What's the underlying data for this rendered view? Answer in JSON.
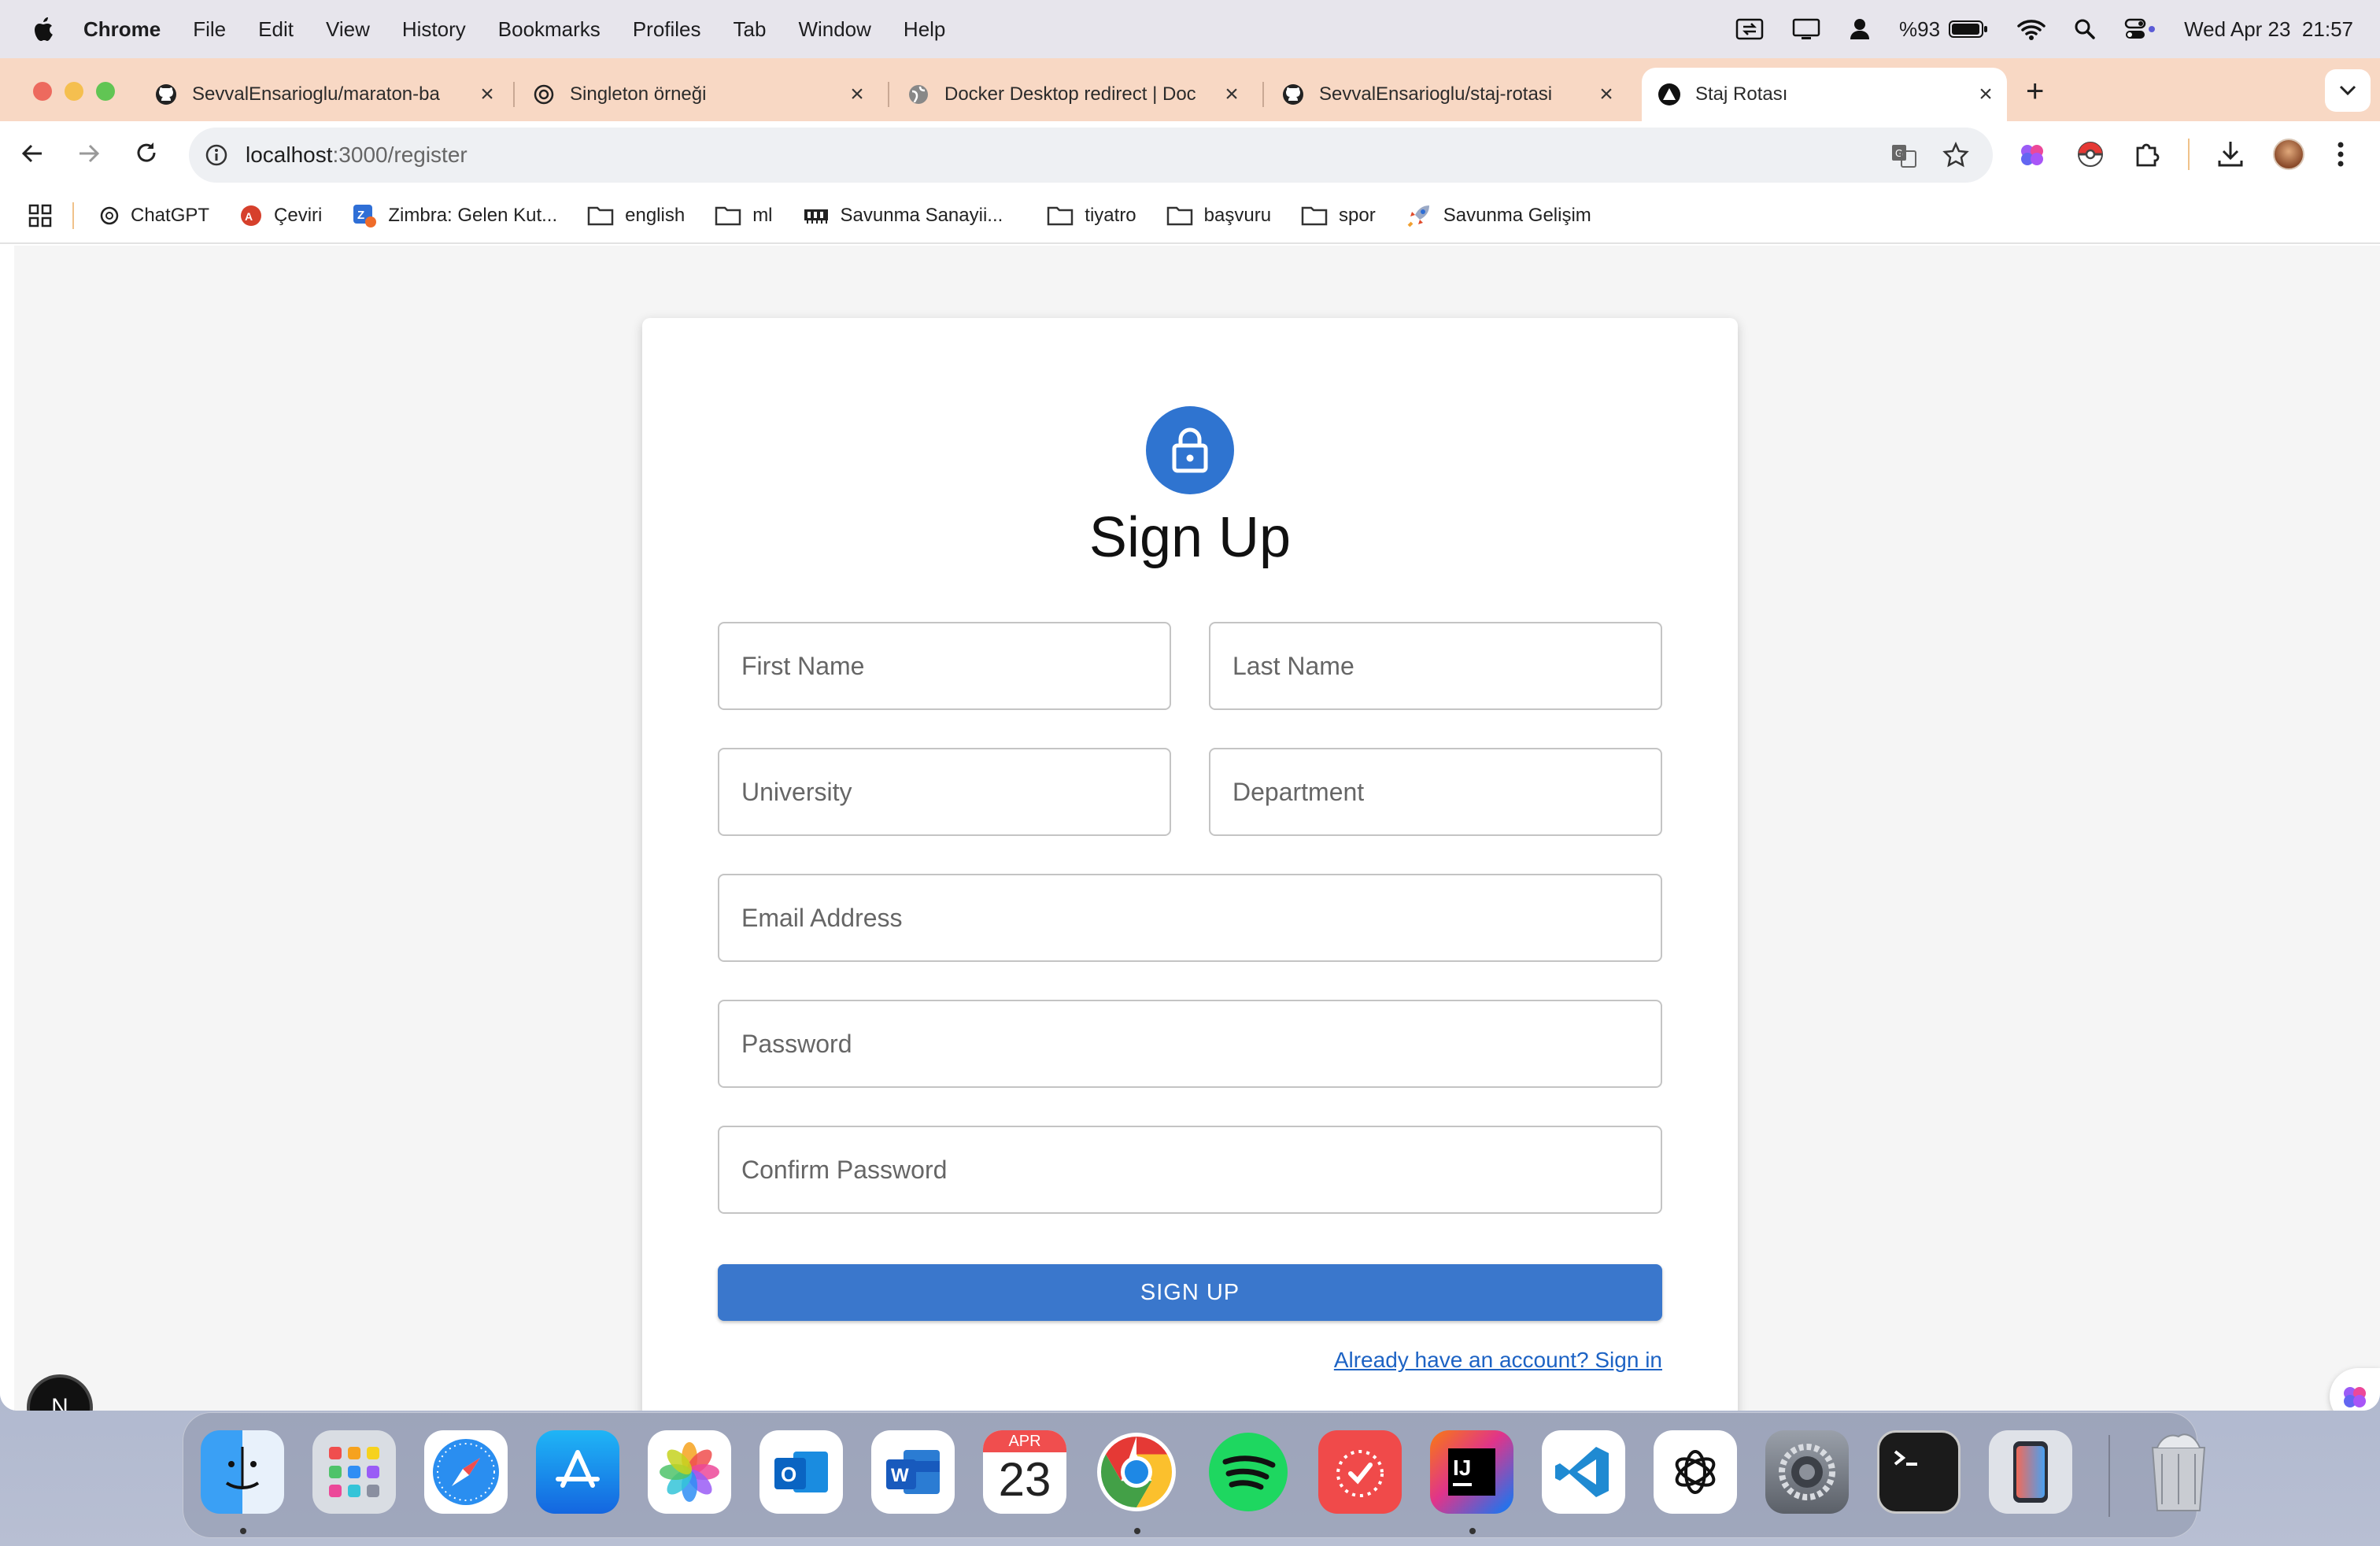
{
  "menubar": {
    "app": "Chrome",
    "items": [
      "File",
      "Edit",
      "View",
      "History",
      "Bookmarks",
      "Profiles",
      "Tab",
      "Window",
      "Help"
    ],
    "battery": "%93",
    "datetime": "Wed Apr 23  21:57"
  },
  "tabs": [
    {
      "title": "SevvalEnsarioglu/maraton-ba",
      "icon": "github-icon"
    },
    {
      "title": "Singleton örneği",
      "icon": "chatgpt-icon"
    },
    {
      "title": "Docker Desktop redirect | Doc",
      "icon": "globe-icon"
    },
    {
      "title": "SevvalEnsarioglu/staj-rotasi",
      "icon": "github-icon"
    },
    {
      "title": "Staj Rotası",
      "icon": "nextjs-icon",
      "active": true
    }
  ],
  "address": {
    "host": "localhost",
    "path": ":3000/register"
  },
  "bookmarks": [
    {
      "label": "ChatGPT",
      "icon": "chatgpt-icon"
    },
    {
      "label": "Çeviri",
      "icon": "translate-icon"
    },
    {
      "label": "Zimbra: Gelen Kut...",
      "icon": "zimbra-icon"
    },
    {
      "label": "english",
      "icon": "folder-icon"
    },
    {
      "label": "ml",
      "icon": "folder-icon"
    },
    {
      "label": "Savunma Sanayii...",
      "icon": "ssb-icon"
    },
    {
      "label": "tiyatro",
      "icon": "folder-icon"
    },
    {
      "label": "başvuru",
      "icon": "folder-icon"
    },
    {
      "label": "spor",
      "icon": "folder-icon"
    },
    {
      "label": "Savunma Gelişim",
      "icon": "rocket-icon"
    }
  ],
  "form": {
    "title": "Sign Up",
    "first_name": "First Name",
    "last_name": "Last Name",
    "university": "University",
    "department": "Department",
    "email": "Email Address",
    "password": "Password",
    "confirm_password": "Confirm Password",
    "submit": "SIGN UP",
    "signin_link": "Already have an account? Sign in"
  },
  "nextjs_badge": "N",
  "dock": {
    "calendar_month": "APR",
    "calendar_day": "23",
    "apps": [
      "finder",
      "launchpad",
      "safari",
      "app-store",
      "photos",
      "outlook",
      "word",
      "calendar",
      "chrome",
      "spotify",
      "reminders",
      "intellij",
      "vscode",
      "chatgpt",
      "system-settings",
      "terminal",
      "iphone-mirroring",
      "trash"
    ]
  },
  "colors": {
    "primary": "#3a77cc",
    "lock": "#2f74d0",
    "tabstrip": "#f8d8c4"
  }
}
